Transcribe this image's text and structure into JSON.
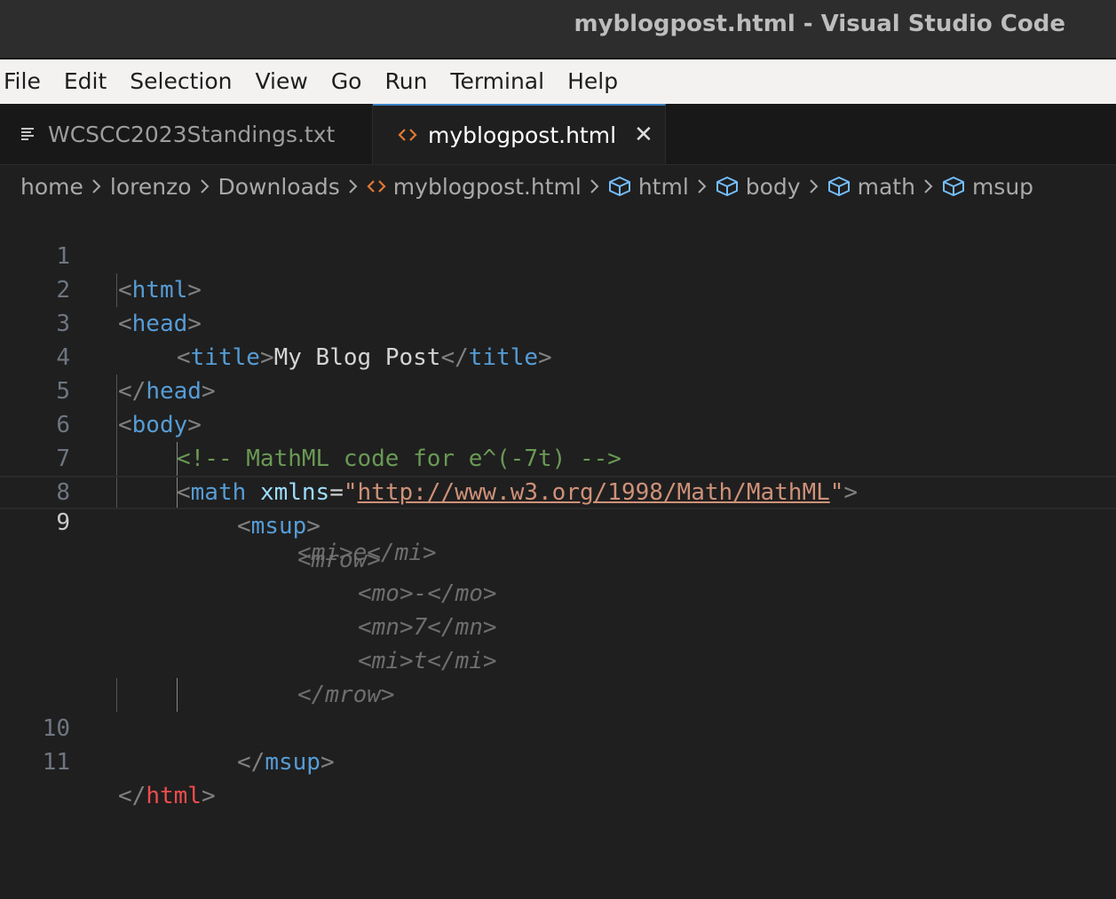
{
  "window": {
    "title": "myblogpost.html - Visual Studio Code"
  },
  "menu": [
    "File",
    "Edit",
    "Selection",
    "View",
    "Go",
    "Run",
    "Terminal",
    "Help"
  ],
  "tabs": [
    {
      "label": "WCSCC2023Standings.txt",
      "icon": "text-file-icon",
      "active": false
    },
    {
      "label": "myblogpost.html",
      "icon": "html-file-icon",
      "active": true
    }
  ],
  "breadcrumb": {
    "path": [
      "home",
      "lorenzo",
      "Downloads"
    ],
    "file": "myblogpost.html",
    "symbols": [
      "html",
      "body",
      "math",
      "msup"
    ]
  },
  "editor": {
    "line_numbers": [
      "1",
      "2",
      "3",
      "4",
      "5",
      "6",
      "7",
      "8",
      "9",
      "10",
      "11"
    ],
    "current_line": "9",
    "code": {
      "l1": {
        "lt": "<",
        "tag": "html",
        "gt": ">"
      },
      "l2": {
        "lt": "<",
        "tag": "head",
        "gt": ">"
      },
      "l3": {
        "lt": "<",
        "tag": "title",
        "gt": ">",
        "text": "My Blog Post",
        "lt2": "</",
        "tag2": "title",
        "gt2": ">"
      },
      "l4": {
        "lt": "</",
        "tag": "head",
        "gt": ">"
      },
      "l5": {
        "lt": "<",
        "tag": "body",
        "gt": ">"
      },
      "l6": {
        "comment": "<!-- MathML code for e^(-7t) -->"
      },
      "l7": {
        "lt": "<",
        "tag": "math",
        "attr": "xmlns",
        "eq": "=",
        "q1": "\"",
        "url": "http://www.w3.org/1998/Math/MathML",
        "q2": "\"",
        "gt": ">"
      },
      "l8": {
        "lt": "<",
        "tag": "msup",
        "gt": ">"
      },
      "l10": {
        "lt": "</",
        "tag": "msup",
        "gt": ">"
      },
      "l11": {
        "lt": "</",
        "tag": "html",
        "gt": ">"
      }
    },
    "ghost_suggestion": [
      "<mi>e</mi>",
      "<mrow>",
      "<mo>-</mo>",
      "<mn>7</mn>",
      "<mi>t</mi>",
      "</mrow>"
    ]
  }
}
